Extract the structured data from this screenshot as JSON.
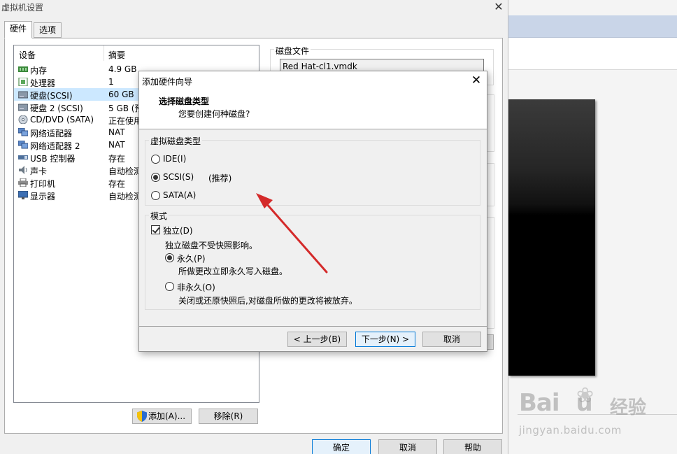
{
  "window": {
    "title": "虚拟机设置"
  },
  "tabs": [
    {
      "label": "硬件"
    },
    {
      "label": "选项"
    }
  ],
  "device_list": {
    "headers": {
      "device": "设备",
      "summary": "摘要"
    },
    "items": [
      {
        "name": "内存",
        "summary": "4.9 GB",
        "icon": "memory-icon"
      },
      {
        "name": "处理器",
        "summary": "1",
        "icon": "cpu-icon"
      },
      {
        "name": "硬盘(SCSI)",
        "summary": "60 GB",
        "icon": "harddisk-icon"
      },
      {
        "name": "硬盘 2 (SCSI)",
        "summary": "5 GB (预",
        "icon": "harddisk-icon"
      },
      {
        "name": "CD/DVD (SATA)",
        "summary": "正在使用",
        "icon": "cdrom-icon"
      },
      {
        "name": "网络适配器",
        "summary": "NAT",
        "icon": "network-icon"
      },
      {
        "name": "网络适配器 2",
        "summary": "NAT",
        "icon": "network-icon"
      },
      {
        "name": "USB 控制器",
        "summary": "存在",
        "icon": "usb-icon"
      },
      {
        "name": "声卡",
        "summary": "自动检测",
        "icon": "speaker-icon"
      },
      {
        "name": "打印机",
        "summary": "存在",
        "icon": "printer-icon"
      },
      {
        "name": "显示器",
        "summary": "自动检测",
        "icon": "monitor-icon"
      }
    ],
    "selected_index": 2
  },
  "device_buttons": {
    "add": "添加(A)...",
    "remove": "移除(R)"
  },
  "disk_file": {
    "label": "磁盘文件",
    "value": "Red Hat-cl1.vmdk"
  },
  "main_buttons": {
    "ok": "确定",
    "cancel": "取消",
    "help": "帮助"
  },
  "wizard": {
    "title": "添加硬件向导",
    "heading": "选择磁盘类型",
    "subheading": "您要创建何种磁盘?",
    "disk_type_group": {
      "label": "虚拟磁盘类型",
      "options": [
        {
          "label": "IDE(I)",
          "checked": false
        },
        {
          "label": "SCSI(S)",
          "checked": true,
          "note": "(推荐)"
        },
        {
          "label": "SATA(A)",
          "checked": false
        }
      ]
    },
    "mode_group": {
      "label": "模式",
      "independent": {
        "label": "独立(D)",
        "checked": true,
        "desc": "独立磁盘不受快照影响。"
      },
      "persistent": {
        "label": "永久(P)",
        "checked": true,
        "desc": "所做更改立即永久写入磁盘。"
      },
      "nonpersistent": {
        "label": "非永久(O)",
        "checked": false,
        "desc": "关闭或还原快照后,对磁盘所做的更改将被放弃。"
      }
    },
    "buttons": {
      "back": "< 上一步(B)",
      "next": "下一步(N) >",
      "cancel": "取消"
    }
  },
  "watermark": {
    "brand": "Bai",
    "brand_suffix": "u",
    "cn": "经验",
    "url": "jingyan.baidu.com"
  },
  "colors": {
    "selection": "#cce8ff",
    "accent": "#0078d7",
    "arrow": "#d42a2a"
  }
}
